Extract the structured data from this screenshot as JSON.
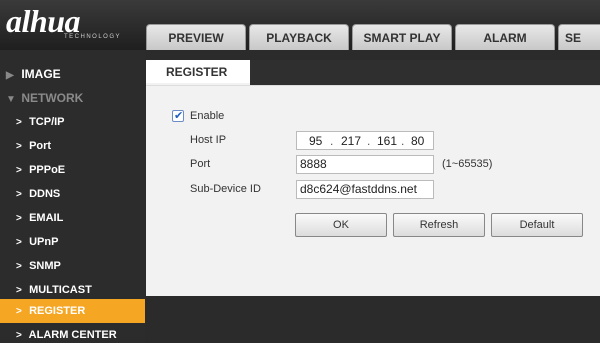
{
  "header": {
    "logo_main": "alhua",
    "logo_sub": "TECHNOLOGY",
    "tabs": [
      "PREVIEW",
      "PLAYBACK",
      "SMART PLAY",
      "ALARM",
      "SE"
    ]
  },
  "sidebar": {
    "items": [
      {
        "label": "IMAGE",
        "state": "collapsed"
      },
      {
        "label": "NETWORK",
        "state": "expanded"
      },
      {
        "label": "TCP/IP"
      },
      {
        "label": "Port"
      },
      {
        "label": "PPPoE"
      },
      {
        "label": "DDNS"
      },
      {
        "label": "EMAIL"
      },
      {
        "label": "UPnP"
      },
      {
        "label": "SNMP"
      },
      {
        "label": "MULTICAST"
      },
      {
        "label": "REGISTER",
        "active": true
      },
      {
        "label": "ALARM CENTER"
      }
    ]
  },
  "content": {
    "tab_label": "REGISTER",
    "enable_label": "Enable",
    "enable_checked": true,
    "host_ip_label": "Host IP",
    "host_ip": [
      "95",
      "217",
      "161",
      "80"
    ],
    "port_label": "Port",
    "port_value": "8888",
    "port_range": "(1~65535)",
    "subdevice_label": "Sub-Device ID",
    "subdevice_value": "d8c624@fastddns.net",
    "buttons": {
      "ok": "OK",
      "refresh": "Refresh",
      "default": "Default"
    }
  },
  "colors": {
    "accent": "#f5a623",
    "header": "#2b2b2b",
    "panel": "#f2f2f2"
  },
  "icons": {
    "chevron_right": "chevron-right-icon",
    "triangle_right": "triangle-right-icon",
    "triangle_down": "triangle-down-icon",
    "checkbox": "check-icon"
  }
}
